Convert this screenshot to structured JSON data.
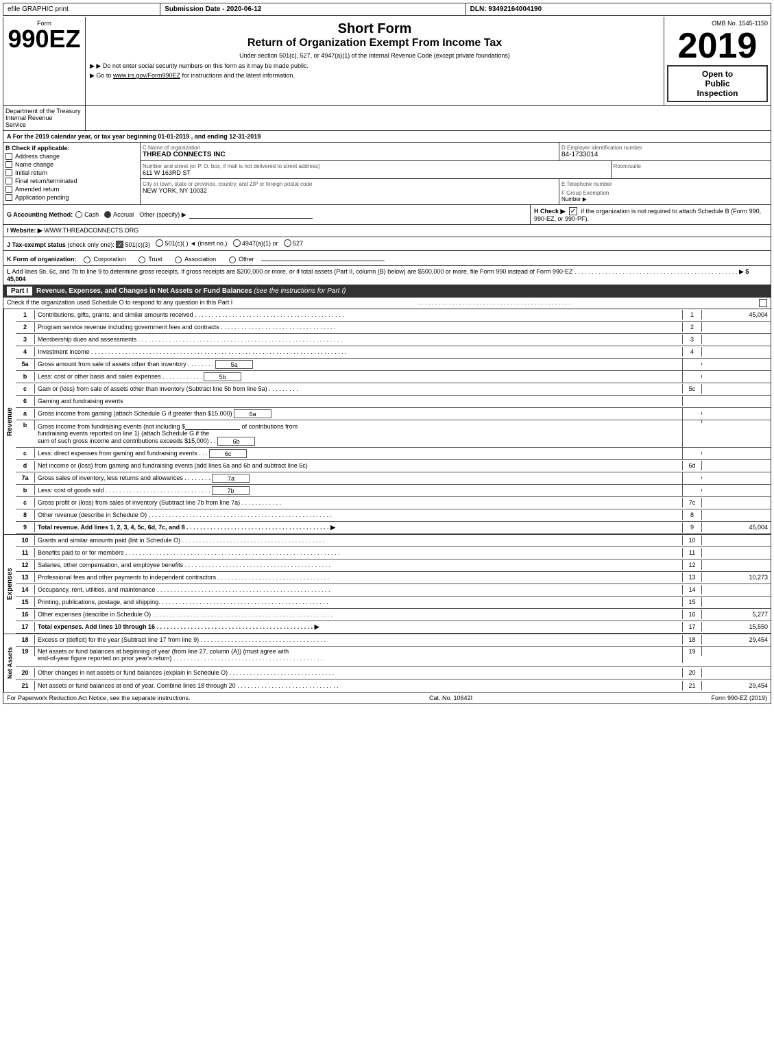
{
  "header": {
    "efile": "efile GRAPHIC print",
    "submission": "Submission Date - 2020-06-12",
    "dln": "DLN: 93492164004190"
  },
  "form": {
    "number": "990EZ",
    "label": "Form",
    "short_form": "Short Form",
    "return_title": "Return of Organization Exempt From Income Tax",
    "subtitle": "Under section 501(c), 527, or 4947(a)(1) of the Internal Revenue Code (except private foundations)",
    "notice1": "▶ Do not enter social security numbers on this form as it may be made public.",
    "notice2": "▶ Go to www.irs.gov/Form990EZ for instructions and the latest information.",
    "omb": "OMB No. 1545-1150",
    "year": "2019",
    "open_to_public": "Open to",
    "public": "Public",
    "inspection": "Inspection"
  },
  "dept": {
    "name": "Department of the Treasury",
    "sub": "Internal Revenue",
    "service": "Service"
  },
  "section_a": {
    "text": "A  For the 2019 calendar year, or tax year beginning 01-01-2019 , and ending 12-31-2019"
  },
  "section_b": {
    "label": "B  Check if applicable:",
    "address_change": "Address change",
    "name_change": "Name change",
    "initial_return": "Initial return",
    "final_return": "Final return/terminated",
    "amended_return": "Amended return",
    "application_pending": "Application pending",
    "c_label": "C Name of organization",
    "org_name": "THREAD CONNECTS INC",
    "address_label": "Number and street (or P. O. box, if mail is not delivered to street address)",
    "address": "611 W 163RD ST",
    "room_label": "Room/suite",
    "room": "",
    "city_label": "City or town, state or province, country, and ZIP or foreign postal code",
    "city": "NEW YORK, NY  10032",
    "d_label": "D Employer identification number",
    "ein": "84-1733014",
    "e_label": "E Telephone number",
    "phone": "",
    "f_label": "F Group Exemption",
    "f_sub": "Number",
    "f_arrow": "▶"
  },
  "section_g": {
    "label": "G Accounting Method:",
    "cash": "Cash",
    "accrual": "Accrual",
    "accrual_checked": true,
    "other": "Other (specify) ▶",
    "h_label": "H  Check ▶",
    "h_check": "✓",
    "h_text": "if the organization is not required to attach Schedule B (Form 990, 990-EZ, or 990-PF)."
  },
  "section_i": {
    "label": "I Website: ▶",
    "website": "WWW.THREADCONNECTS.ORG"
  },
  "section_j": {
    "text": "J Tax-exempt status (check only one): ☑ 501(c)(3) ○ 501(c)(  ) ◄ (insert no.) ○ 4947(a)(1) or ○ 527"
  },
  "section_k": {
    "text": "K Form of organization:   ○ Corporation   ○ Trust   ○ Association   ○ Other"
  },
  "section_l": {
    "text": "L Add lines 5b, 6c, and 7b to line 9 to determine gross receipts. If gross receipts are $200,000 or more, or if total assets (Part II, column (B) below) are $500,000 or more, file Form 990 instead of Form 990-EZ",
    "dots": ". . . . . . . . . . . . . . . . . . . . . . . . . . . . . . . . . . . . . . . . . . . . . . . .",
    "arrow": "▶",
    "value": "$ 45,004"
  },
  "part1": {
    "label": "Part I",
    "title": "Revenue, Expenses, and Changes in Net Assets or Fund Balances",
    "see_instructions": "(see the instructions for Part I)",
    "check_note": "Check if the organization used Schedule O to respond to any question in this Part I",
    "check_dots": ". . . . . . . . . . . . . . . . . . . . . . . . . . . . . . . . . . . . . . . . . . . . .",
    "rows": [
      {
        "num": "1",
        "desc": "Contributions, gifts, grants, and similar amounts received",
        "dots": ". . . . . . . . . . . . . . . . . . . . . . . . . . . . . . . .",
        "line": "1",
        "value": "45,004"
      },
      {
        "num": "2",
        "desc": "Program service revenue including government fees and contracts",
        "dots": ". . . . . . . . . . . . . . . . . . . . . . . . . .",
        "line": "2",
        "value": ""
      },
      {
        "num": "3",
        "desc": "Membership dues and assessments",
        "dots": ". . . . . . . . . . . . . . . . . . . . . . . . . . . . . . . . . . . . . . . . . . . . . . . . . . . . .",
        "line": "3",
        "value": ""
      },
      {
        "num": "4",
        "desc": "Investment income",
        "dots": ". . . . . . . . . . . . . . . . . . . . . . . . . . . . . . . . . . . . . . . . . . . . . . . . . . . . . . . . . . . . . . . . . . . . . .",
        "line": "4",
        "value": ""
      }
    ],
    "row5a": {
      "num": "5a",
      "desc": "Gross amount from sale of assets other than inventory",
      "dots": ". . . . . . . .",
      "sub_box": "5a",
      "value": ""
    },
    "row5b": {
      "num": "b",
      "desc": "Less: cost or other basis and sales expenses",
      "dots": ". . . . . . . . . . .",
      "sub_box": "5b",
      "value": ""
    },
    "row5c": {
      "num": "c",
      "desc": "Gain or (loss) from sale of assets other than inventory (Subtract line 5b from line 5a)",
      "dots": ". . . . . . .",
      "line": "5c",
      "value": ""
    },
    "row6": {
      "num": "6",
      "desc": "Gaming and fundraising events"
    },
    "row6a": {
      "num": "a",
      "desc": "Gross income from gaming (attach Schedule G if greater than $15,000)",
      "sub_box": "6a",
      "value": ""
    },
    "row6b_desc1": "Gross income from fundraising events (not including $",
    "row6b_desc2": "of contributions from",
    "row6b_desc3": "fundraising events reported on line 1) (attach Schedule G if the",
    "row6b_desc4": "sum of such gross income and contributions exceeds $15,000)",
    "row6b_dots": ". . .",
    "row6b_box": "6b",
    "row6c": {
      "num": "c",
      "desc": "Less: direct expenses from gaming and fundraising events",
      "dots": ". . .",
      "sub_box": "6c",
      "value": ""
    },
    "row6d": {
      "num": "d",
      "desc": "Net income or (loss) from gaming and fundraising events (add lines 6a and 6b and subtract line 6c)",
      "line": "6d",
      "value": ""
    },
    "row7a": {
      "num": "7a",
      "desc": "Gross sales of inventory, less returns and allowances",
      "dots": ". . . . . . . .",
      "sub_box": "7a",
      "value": ""
    },
    "row7b": {
      "num": "b",
      "desc": "Less: cost of goods sold",
      "dots": ". . . . . . . . . . . . . . . . . . . . . . . . . . . . . . .",
      "sub_box": "7b",
      "value": ""
    },
    "row7c": {
      "num": "c",
      "desc": "Gross profit or (loss) from sales of inventory (Subtract line 7b from line 7a)",
      "dots": ". . . . . . . . . . .",
      "line": "7c",
      "value": ""
    },
    "row8": {
      "num": "8",
      "desc": "Other revenue (describe in Schedule O)",
      "dots": ". . . . . . . . . . . . . . . . . . . . . . . . . . . . . . . . . . . . . . . . . . . . . . . . . . . . . . .",
      "line": "8",
      "value": ""
    },
    "row9": {
      "num": "9",
      "desc": "Total revenue. Add lines 1, 2, 3, 4, 5c, 6d, 7c, and 8",
      "dots": ". . . . . . . . . . . . . . . . . . . . . . . . . . . . . . . . . . . . . . . . .",
      "arrow": "▶",
      "line": "9",
      "value": "45,004"
    }
  },
  "expenses": {
    "label": "Expenses",
    "rows": [
      {
        "num": "10",
        "desc": "Grants and similar amounts paid (list in Schedule O)",
        "dots": ". . . . . . . . . . . . . . . . . . . . . . . . . . . . . . . . . . . . . . . . .",
        "line": "10",
        "value": ""
      },
      {
        "num": "11",
        "desc": "Benefits paid to or for members",
        "dots": ". . . . . . . . . . . . . . . . . . . . . . . . . . . . . . . . . . . . . . . . . . . . . . . . . . . . . . . . . . . . .",
        "line": "11",
        "value": ""
      },
      {
        "num": "12",
        "desc": "Salaries, other compensation, and employee benefits",
        "dots": ". . . . . . . . . . . . . . . . . . . . . . . . . . . . . . . . . . . . . . . . . . .",
        "line": "12",
        "value": ""
      },
      {
        "num": "13",
        "desc": "Professional fees and other payments to independent contractors",
        "dots": ". . . . . . . . . . . . . . . . . . . . . . . . . . . . . . . . . . . .",
        "line": "13",
        "value": "10,273"
      },
      {
        "num": "14",
        "desc": "Occupancy, rent, utilities, and maintenance",
        "dots": ". . . . . . . . . . . . . . . . . . . . . . . . . . . . . . . . . . . . . . . . . . . . . . . . . . . .",
        "line": "14",
        "value": ""
      },
      {
        "num": "15",
        "desc": "Printing, publications, postage, and shipping.",
        "dots": ". . . . . . . . . . . . . . . . . . . . . . . . . . . . . . . . . . . . . . . . . . . . . . . . . . .",
        "line": "15",
        "value": ""
      },
      {
        "num": "16",
        "desc": "Other expenses (describe in Schedule O)",
        "dots": ". . . . . . . . . . . . . . . . . . . . . . . . . . . . . . . . . . . . . . . . . . . . . . . . . . . . . .",
        "line": "16",
        "value": "5,277"
      },
      {
        "num": "17",
        "desc": "Total expenses. Add lines 10 through 16",
        "dots": ". . . . . . . . . . . . . . . . . . . . . . . . . . . . . . . . . . . . . .",
        "arrow": "▶",
        "line": "17",
        "value": "15,550",
        "bold": true
      }
    ]
  },
  "net_assets": {
    "label": "Net Assets",
    "rows": [
      {
        "num": "18",
        "desc": "Excess or (deficit) for the year (Subtract line 17 from line 9)",
        "dots": ". . . . . . . . . . . . . . . . . . . . . . . . . . . . . . .",
        "line": "18",
        "value": "29,454"
      },
      {
        "num": "19",
        "desc": "Net assets or fund balances at beginning of year (from line 27, column (A)) (must agree with",
        "line": "",
        "value": ""
      },
      {
        "num": "",
        "desc": "end-of-year figure reported on prior year's return)",
        "dots": ". . . . . . . . . . . . . . . . . . . . . . . . . . . . . . . . . . . . . . . . . . . . . . . . . .",
        "line": "19",
        "value": ""
      },
      {
        "num": "20",
        "desc": "Other changes in net assets or fund balances (explain in Schedule O)",
        "dots": ". . . . . . . . . . . . . . . . . . . . . . . . . . . . . . . . . . . .",
        "line": "20",
        "value": ""
      },
      {
        "num": "21",
        "desc": "Net assets or fund balances at end of year. Combine lines 18 through 20",
        "dots": ". . . . . . . . . . . . . . . . . . . . . . . . . . . . . . . . .",
        "line": "21",
        "value": "29,454"
      }
    ]
  },
  "footer": {
    "paperwork_notice": "For Paperwork Reduction Act Notice, see the separate instructions.",
    "cat_no": "Cat. No. 10642I",
    "form_ref": "Form 990-EZ (2019)"
  }
}
